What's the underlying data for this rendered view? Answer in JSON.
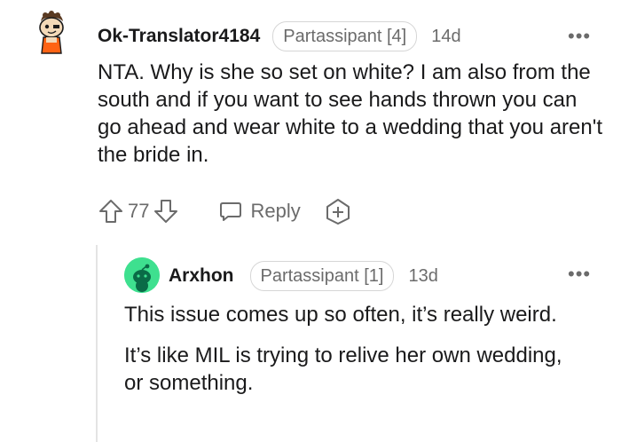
{
  "comments": [
    {
      "username": "Ok-Translator4184",
      "flair": "Partassipant [4]",
      "time": "14d",
      "more": "•••",
      "avatar_icon": "snoo-avatar-icon",
      "body": [
        "NTA. Why is she so set on white? I am also from the south and if you want to see hands thrown you can go ahead and wear white to a wedding that you aren't the bride in."
      ],
      "votes": "77",
      "reply_label": "Reply"
    },
    {
      "username": "Arxhon",
      "flair": "Partassipant [1]",
      "time": "13d",
      "more": "•••",
      "avatar_icon": "default-snoo-avatar-icon",
      "body": [
        "This issue comes up so often, it’s really weird.",
        "It’s like MIL is trying to relive her own wedding, or something."
      ]
    }
  ],
  "colors": {
    "text": "#1a1a1b",
    "meta": "#6b6b6b",
    "thread": "#e4e4e4",
    "avatar2_bg": "#3ee08f"
  }
}
